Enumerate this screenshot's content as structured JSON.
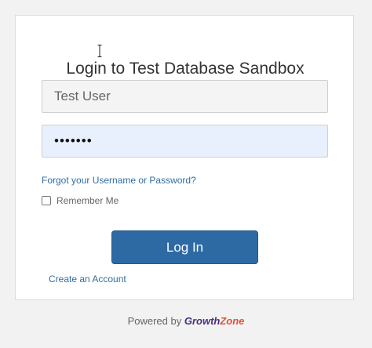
{
  "login": {
    "title": "Login to Test Database Sandbox",
    "username_placeholder": "Test User",
    "password_value": "•••••••",
    "forgot_link": "Forgot your Username or Password?",
    "remember_label": "Remember Me",
    "remember_checked": false,
    "login_button": "Log In",
    "create_account_link": "Create an Account"
  },
  "footer": {
    "powered_by": "Powered by",
    "brand_part1": "Growth",
    "brand_part2": "Zone"
  },
  "colors": {
    "button": "#2d6aa3",
    "link": "#2f6ea3",
    "brand_purple": "#4b2f7f",
    "brand_orange": "#e0533a"
  }
}
